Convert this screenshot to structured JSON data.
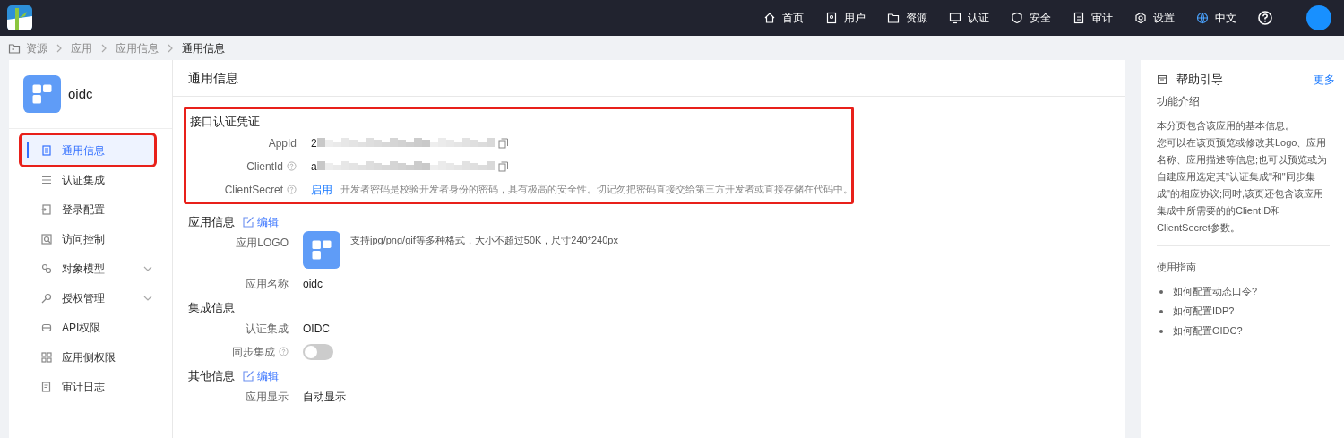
{
  "top_nav": {
    "items": [
      {
        "label": "首页"
      },
      {
        "label": "用户"
      },
      {
        "label": "资源"
      },
      {
        "label": "认证"
      },
      {
        "label": "安全"
      },
      {
        "label": "审计"
      },
      {
        "label": "设置"
      },
      {
        "label": "中文"
      }
    ]
  },
  "breadcrumb": [
    "资源",
    "应用",
    "应用信息",
    "通用信息"
  ],
  "app": {
    "name": "oidc"
  },
  "sidebar": {
    "items": [
      {
        "label": "通用信息",
        "selected": true,
        "highlighted": true,
        "kind": "link"
      },
      {
        "label": "认证集成",
        "selected": false,
        "highlighted": false,
        "kind": "link"
      },
      {
        "label": "登录配置",
        "selected": false,
        "highlighted": false,
        "kind": "link"
      },
      {
        "label": "访问控制",
        "selected": false,
        "highlighted": false,
        "kind": "link"
      },
      {
        "label": "对象模型",
        "selected": false,
        "highlighted": false,
        "kind": "group"
      },
      {
        "label": "授权管理",
        "selected": false,
        "highlighted": false,
        "kind": "group"
      },
      {
        "label": "API权限",
        "selected": false,
        "highlighted": false,
        "kind": "link"
      },
      {
        "label": "应用侧权限",
        "selected": false,
        "highlighted": false,
        "kind": "link"
      },
      {
        "label": "审计日志",
        "selected": false,
        "highlighted": false,
        "kind": "link"
      }
    ]
  },
  "main": {
    "title": "通用信息",
    "credentials": {
      "title": "接口认证凭证",
      "highlighted": true,
      "fields": [
        {
          "label": "AppId",
          "help": false,
          "kind": "masked",
          "value": "2"
        },
        {
          "label": "ClientId",
          "help": true,
          "kind": "masked",
          "value": "a"
        },
        {
          "label": "ClientSecret",
          "help": true,
          "kind": "secret",
          "link": "启用",
          "note": "开发者密码是校验开发者身份的密码，具有极高的安全性。切记勿把密码直接交给第三方开发者或直接存储在代码中。"
        }
      ]
    },
    "sections": [
      {
        "title": "应用信息",
        "edit": "编辑",
        "fields": [
          {
            "label": "应用LOGO",
            "help": false,
            "kind": "logo",
            "note": "支持jpg/png/gif等多种格式，大小不超过50K，尺寸240*240px"
          },
          {
            "label": "应用名称",
            "help": false,
            "kind": "text",
            "value": "oidc"
          }
        ]
      },
      {
        "title": "集成信息",
        "fields": [
          {
            "label": "认证集成",
            "help": false,
            "kind": "text",
            "value": "OIDC"
          },
          {
            "label": "同步集成",
            "help": true,
            "kind": "toggle",
            "on": false
          }
        ]
      },
      {
        "title": "其他信息",
        "edit": "编辑",
        "fields": [
          {
            "label": "应用显示",
            "help": false,
            "kind": "text",
            "value": "自动显示"
          }
        ]
      }
    ]
  },
  "help_panel": {
    "title": "帮助引导",
    "more": "更多",
    "intro_title": "功能介绍",
    "intro": [
      "本分页包含该应用的基本信息。",
      "您可以在该页预览或修改其Logo、应用名称、应用描述等信息;也可以预览或为自建应用选定其\"认证集成\"和\"同步集成\"的相应协议;同时,该页还包含该应用集成中所需要的的ClientID和ClientSecret参数。"
    ],
    "guide_title": "使用指南",
    "guides": [
      "如何配置动态口令?",
      "如何配置IDP?",
      "如何配置OIDC?"
    ]
  }
}
